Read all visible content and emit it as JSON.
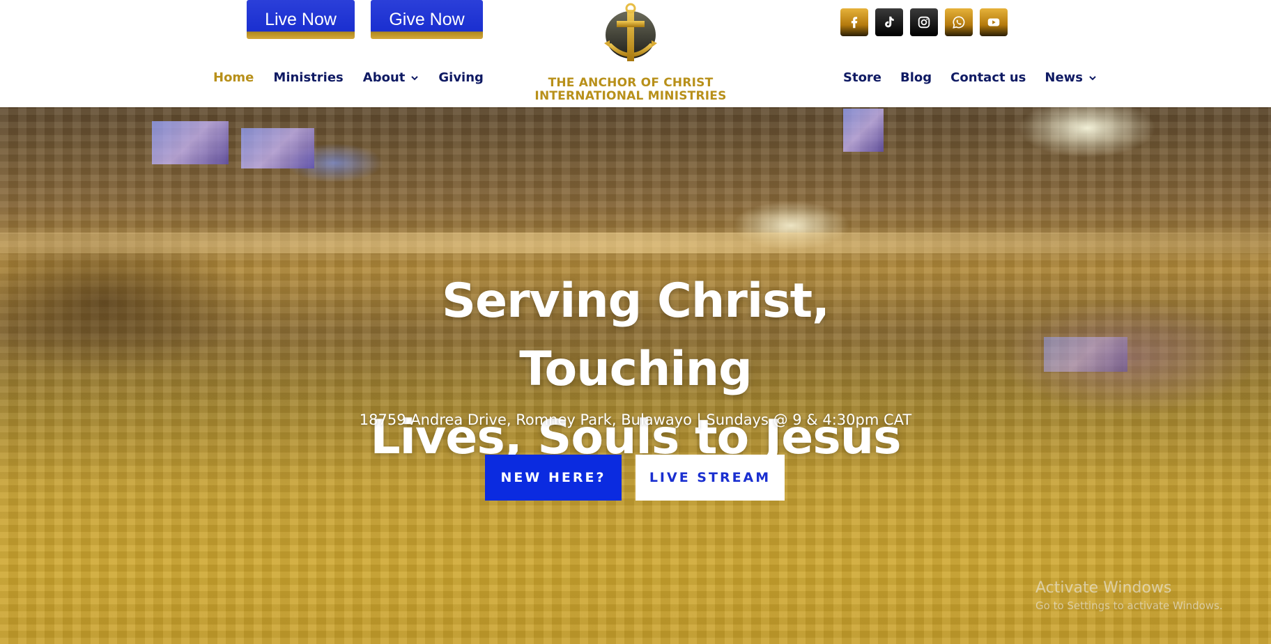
{
  "header": {
    "top_buttons": {
      "live_now": "Live Now",
      "give_now": "Give Now"
    },
    "logo": {
      "line1": "THE ANCHOR OF CHRIST",
      "line2": "INTERNATIONAL MINISTRIES"
    },
    "social": [
      {
        "name": "facebook-icon",
        "style": "gold"
      },
      {
        "name": "tiktok-icon",
        "style": "dark"
      },
      {
        "name": "instagram-icon",
        "style": "dark"
      },
      {
        "name": "whatsapp-icon",
        "style": "gold"
      },
      {
        "name": "youtube-icon",
        "style": "gold"
      }
    ],
    "nav_left": [
      {
        "label": "Home",
        "active": true
      },
      {
        "label": "Ministries"
      },
      {
        "label": "About",
        "has_dropdown": true
      },
      {
        "label": "Giving"
      }
    ],
    "nav_right": [
      {
        "label": "Store"
      },
      {
        "label": "Blog"
      },
      {
        "label": "Contact us"
      },
      {
        "label": "News",
        "has_dropdown": true
      }
    ]
  },
  "hero": {
    "title_line1": "Serving Christ, Touching",
    "title_line2": "Lives, Souls to Jesus",
    "subtitle": "18759 Andrea  Drive,  Romney  Park,  Bulawayo  | Sundays @ 9 & 4:30pm CAT",
    "cta_new": "NEW HERE?",
    "cta_live": "LIVE STREAM"
  },
  "watermark": {
    "title": "Activate Windows",
    "subtitle": "Go to Settings to activate Windows."
  },
  "colors": {
    "nav_text": "#0f1a63",
    "nav_active": "#b8901a",
    "primary_blue": "#0b2be0",
    "gold": "#b8901a"
  }
}
